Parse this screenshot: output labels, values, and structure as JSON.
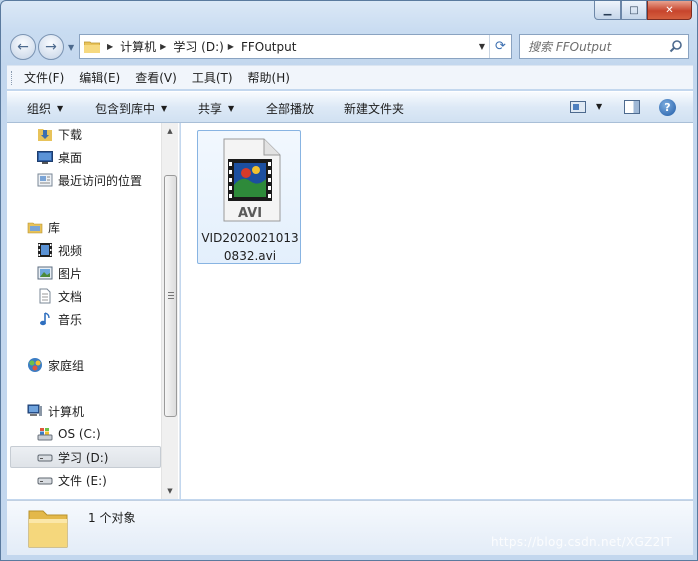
{
  "window": {
    "caption": {
      "minimize": "▁",
      "maximize": "□",
      "close": "✕"
    }
  },
  "navigation": {
    "back_icon": "back-arrow-icon",
    "forward_icon": "forward-arrow-icon",
    "breadcrumbs": [
      "计算机",
      "学习 (D:)",
      "FFOutput"
    ],
    "refresh_icon": "refresh-icon"
  },
  "search": {
    "placeholder": "搜索 FFOutput"
  },
  "menubar": {
    "items": [
      "文件(F)",
      "编辑(E)",
      "查看(V)",
      "工具(T)",
      "帮助(H)"
    ]
  },
  "toolbar": {
    "organize": "组织",
    "include_in_library": "包含到库中",
    "share": "共享",
    "play_all": "全部播放",
    "new_folder": "新建文件夹",
    "help": "?"
  },
  "nav_pane": {
    "favorites": [
      "下载",
      "桌面",
      "最近访问的位置"
    ],
    "libraries_title": "库",
    "libraries": [
      "视频",
      "图片",
      "文档",
      "音乐"
    ],
    "homegroup": "家庭组",
    "computer_title": "计算机",
    "drives": [
      "OS (C:)",
      "学习 (D:)",
      "文件 (E:)"
    ],
    "selected": "学习 (D:)"
  },
  "files": [
    {
      "name": "VID20200210130832.avi",
      "badge": "AVI",
      "icon": "avi-video-file-icon"
    }
  ],
  "details_pane": {
    "count": "1 个对象"
  },
  "watermark": "https://blog.csdn.net/XGZ2IT",
  "colors": {
    "selection_border": "#88b4e2",
    "window_frame": "#c3d7ee",
    "close_red": "#c7452d"
  }
}
